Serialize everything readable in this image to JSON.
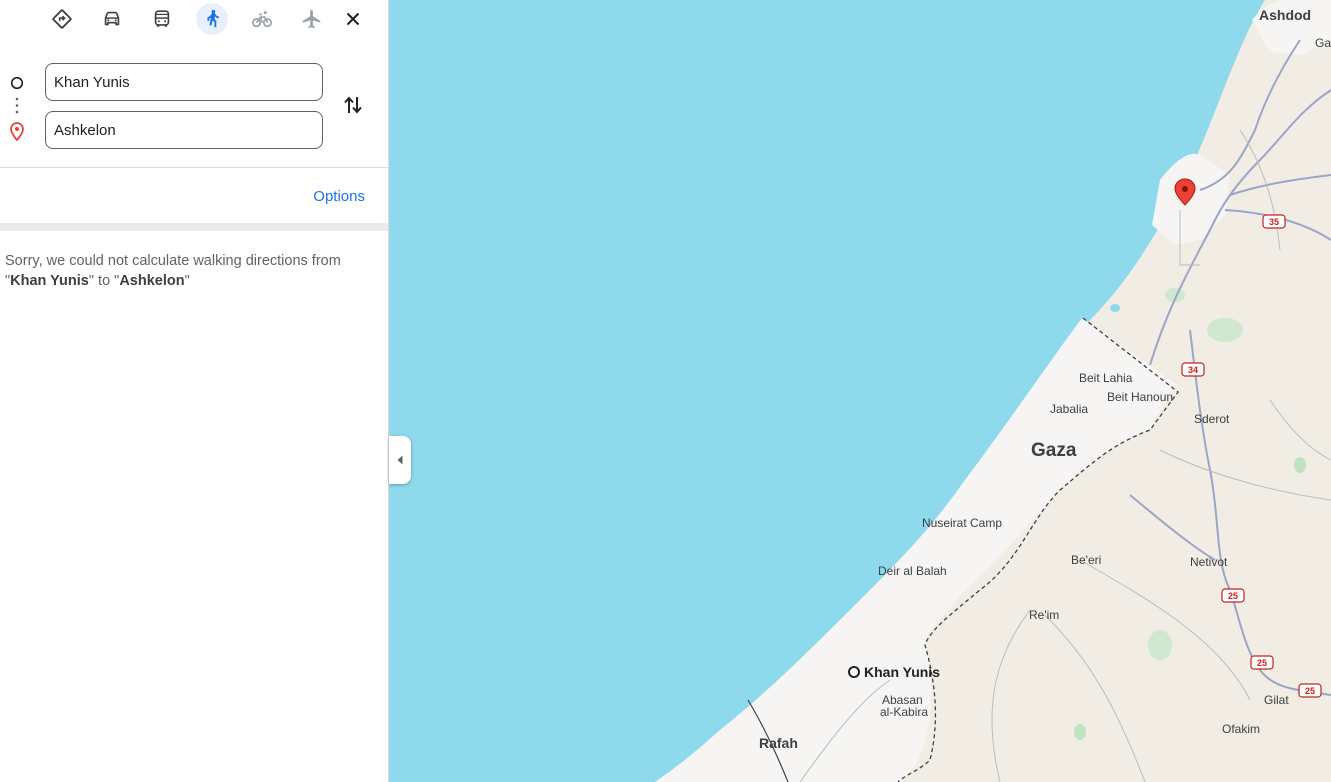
{
  "travel_modes": [
    {
      "name": "best",
      "icon": "directions-icon"
    },
    {
      "name": "driving",
      "icon": "car-icon"
    },
    {
      "name": "transit",
      "icon": "bus-icon"
    },
    {
      "name": "walking",
      "icon": "walk-icon",
      "active": true
    },
    {
      "name": "cycling",
      "icon": "bike-icon"
    },
    {
      "name": "flights",
      "icon": "airplane-icon"
    }
  ],
  "origin": {
    "value": "Khan Yunis",
    "icon": "origin-circle-icon"
  },
  "destination": {
    "value": "Ashkelon",
    "icon": "destination-pin-icon"
  },
  "options_label": "Options",
  "error": {
    "prefix": "Sorry, we could not calculate walking directions from \"",
    "from": "Khan Yunis",
    "middle": "\" to \"",
    "to": "Ashkelon",
    "suffix": "\""
  },
  "colors": {
    "accent": "#1a73e8",
    "water": "#8fd9ec",
    "land": "#f1ede4",
    "urban": "#f5f5f5",
    "pin": "#ea4335"
  },
  "map": {
    "labels": {
      "ashdod": "Ashdod",
      "gan": "Gan",
      "beit_lahia": "Beit Lahia",
      "beit_hanoun": "Beit Hanoun",
      "jabalia": "Jabalia",
      "sderot": "Sderot",
      "gaza": "Gaza",
      "nuseirat": "Nuseirat Camp",
      "deir_al_balah": "Deir al Balah",
      "beeri": "Be'eri",
      "netivot": "Netivot",
      "reim": "Re'im",
      "khan_yunis": "Khan Yunis",
      "abasan_1": "Abasan",
      "abasan_2": "al-Kabira",
      "rafah": "Rafah",
      "gilat": "Gilat",
      "ofakim": "Ofakim"
    },
    "shields": [
      "35",
      "34",
      "25",
      "25",
      "25"
    ]
  }
}
